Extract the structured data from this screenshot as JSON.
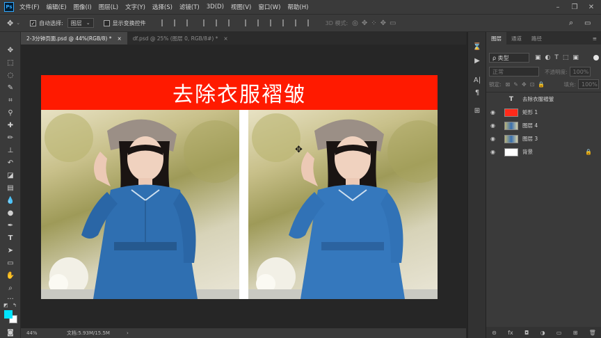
{
  "app": {
    "logo": "Ps"
  },
  "menubar": {
    "items": [
      "文件(F)",
      "编辑(E)",
      "图像(I)",
      "图层(L)",
      "文字(Y)",
      "选择(S)",
      "滤镜(T)",
      "3D(D)",
      "视图(V)",
      "窗口(W)",
      "帮助(H)"
    ]
  },
  "options": {
    "auto_select_label": "自动选择:",
    "auto_select_value": "图层",
    "show_transform_label": "显示变换控件",
    "mode_3d_label": "3D 模式:"
  },
  "tabs": [
    {
      "label": "2-3分钟页面.psd @ 44%(RGB/8) *",
      "close": "×"
    },
    {
      "label": "df.psd @ 25% (图层 0, RGB/8#) *",
      "close": "×"
    }
  ],
  "document": {
    "banner_text": "去除衣服褶皱",
    "banner_color": "#ff1a00"
  },
  "status": {
    "zoom": "44%",
    "doc_info": "文档:5.93M/15.5M"
  },
  "colors": {
    "foreground": "#00e5ff",
    "background": "#ffffff",
    "accent": "#31a8ff"
  },
  "panel": {
    "tabs": [
      "图层",
      "通道",
      "路径"
    ],
    "filter_label": "ρ 类型",
    "blend_mode": "正常",
    "opacity_label": "不透明度:",
    "opacity_value": "100%",
    "lock_label": "锁定:",
    "fill_label": "填充:",
    "fill_value": "100%",
    "layers": [
      {
        "name": "去除衣服褶皱",
        "kind": "text",
        "glyph": "T"
      },
      {
        "name": "矩形 1",
        "kind": "shape"
      },
      {
        "name": "图层 4",
        "kind": "image"
      },
      {
        "name": "图层 3",
        "kind": "image"
      },
      {
        "name": "背景",
        "kind": "background",
        "locked": true
      }
    ],
    "bottom_icons": [
      "link-icon",
      "fx-icon",
      "mask-icon",
      "adjustment-icon",
      "group-icon",
      "new-layer-icon",
      "trash-icon"
    ]
  }
}
